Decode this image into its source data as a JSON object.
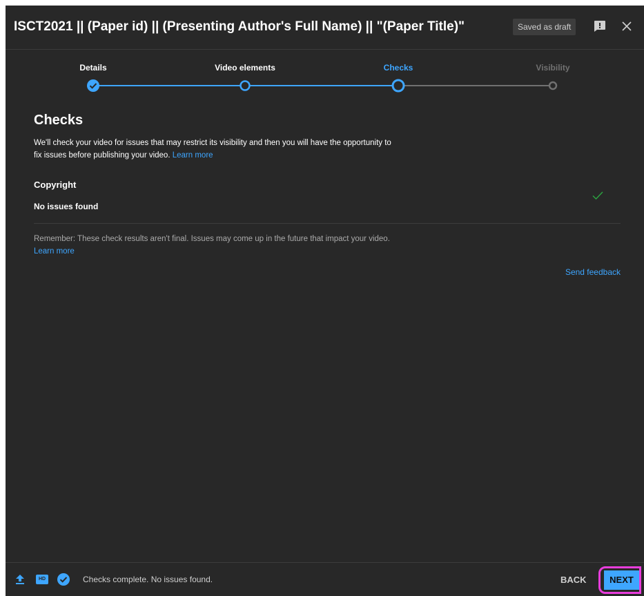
{
  "header": {
    "title": "ISCT2021 || (Paper id) || (Presenting Author's Full Name) || \"(Paper Title)\"",
    "saved_label": "Saved as draft"
  },
  "stepper": {
    "steps": [
      {
        "label": "Details",
        "state": "completed"
      },
      {
        "label": "Video elements",
        "state": "completed"
      },
      {
        "label": "Checks",
        "state": "current"
      },
      {
        "label": "Visibility",
        "state": "upcoming"
      }
    ]
  },
  "checks": {
    "title": "Checks",
    "intro": "We'll check your video for issues that may restrict its visibility and then you will have the opportunity to fix issues before publishing your video.",
    "intro_link": "Learn more",
    "copyright_title": "Copyright",
    "copyright_status": "No issues found",
    "remember": "Remember: These check results aren't final. Issues may come up in the future that impact your video.",
    "remember_link": "Learn more",
    "send_feedback": "Send feedback"
  },
  "footer": {
    "hd_badge": "HD",
    "status": "Checks complete. No issues found.",
    "back_label": "BACK",
    "next_label": "NEXT"
  },
  "colors": {
    "background": "#282828",
    "accent": "#3ea6ff",
    "success": "#2ba640",
    "highlight": "#e83ddc",
    "muted_text": "#aaaaaa"
  }
}
